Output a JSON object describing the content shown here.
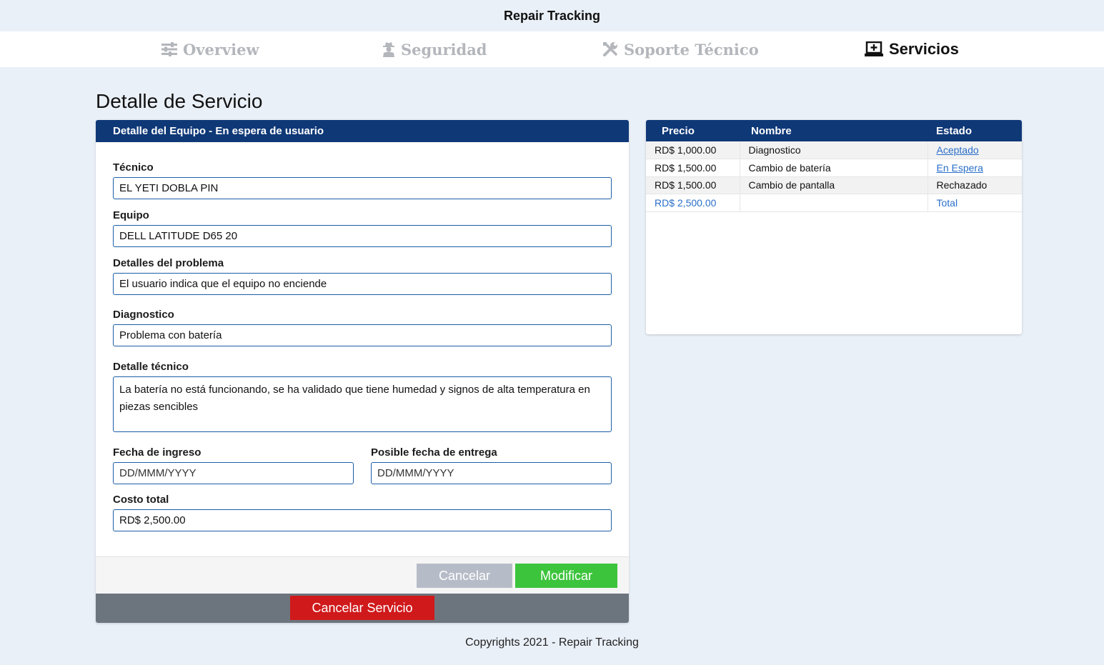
{
  "app": {
    "title": "Repair Tracking"
  },
  "nav": {
    "items": [
      {
        "label": "Overview",
        "icon": "sliders-icon",
        "active": false
      },
      {
        "label": "Seguridad",
        "icon": "user-secret-icon",
        "active": false
      },
      {
        "label": "Soporte Técnico",
        "icon": "tools-icon",
        "active": false
      },
      {
        "label": "Servicios",
        "icon": "laptop-medical-icon",
        "active": true
      }
    ]
  },
  "page": {
    "title": "Detalle de Servicio"
  },
  "form": {
    "header": "Detalle del Equipo - En espera de usuario",
    "tecnico": {
      "label": "Técnico",
      "value": "EL YETI DOBLA PIN"
    },
    "equipo": {
      "label": "Equipo",
      "value": "DELL LATITUDE D65 20"
    },
    "problema": {
      "label": "Detalles del problema",
      "value": "El usuario indica que el equipo no enciende"
    },
    "diagnostico": {
      "label": "Diagnostico",
      "value": "Problema con batería"
    },
    "detalle_tecnico": {
      "label": "Detalle técnico",
      "value": "La batería no está funcionando, se ha validado que tiene humedad y signos de alta temperatura en piezas sencibles"
    },
    "fecha_ingreso": {
      "label": "Fecha de ingreso",
      "placeholder": "DD/MMM/YYYY"
    },
    "fecha_entrega": {
      "label": "Posible fecha de entrega",
      "placeholder": "DD/MMM/YYYY"
    },
    "costo_total": {
      "label": "Costo total",
      "value": "RD$ 2,500.00"
    },
    "cancel_label": "Cancelar",
    "modify_label": "Modificar",
    "cancel_service_label": "Cancelar Servicio"
  },
  "services_table": {
    "headers": {
      "precio": "Precio",
      "nombre": "Nombre",
      "estado": "Estado"
    },
    "rows": [
      {
        "precio": "RD$ 1,000.00",
        "nombre": "Diagnostico",
        "estado": "Aceptado"
      },
      {
        "precio": "RD$ 1,500.00",
        "nombre": "Cambio de batería",
        "estado": "En Espera"
      },
      {
        "precio": "RD$ 1,500.00",
        "nombre": "Cambio de pantalla",
        "estado": "Rechazado"
      }
    ],
    "total": {
      "precio": "RD$ 2,500.00",
      "label": "Total"
    }
  },
  "footer": {
    "copyright": "Copyrights 2021 - Repair Tracking"
  },
  "colors": {
    "primary": "#0f3877",
    "background": "#eaf0f8",
    "success": "#3cc43c",
    "danger": "#d0191b",
    "muted": "#b6bcc7",
    "link": "#2a6fc9"
  }
}
